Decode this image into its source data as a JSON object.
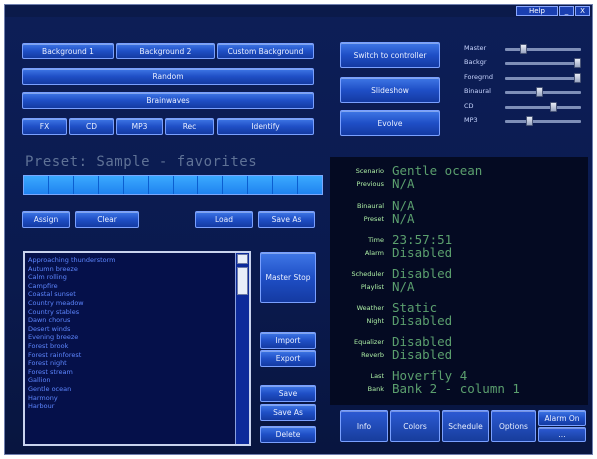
{
  "titlebar": {
    "help": "Help",
    "minimize": "_",
    "close": "X"
  },
  "top_buttons": {
    "background1": "Background 1",
    "background2": "Background 2",
    "custom_background": "Custom Background",
    "random": "Random",
    "brainwaves": "Brainwaves",
    "fx": "FX",
    "cd": "CD",
    "mp3": "MP3",
    "rec": "Rec",
    "identify": "Identify"
  },
  "mid_buttons": {
    "switch_to_controller": "Switch to controller",
    "slideshow": "Slideshow",
    "evolve": "Evolve"
  },
  "sliders": [
    {
      "label": "Master",
      "level": 0.22
    },
    {
      "label": "Backgr",
      "level": 1.0
    },
    {
      "label": "Foregrnd",
      "level": 1.0
    },
    {
      "label": "Binaural",
      "level": 0.45
    },
    {
      "label": "CD",
      "level": 0.65
    },
    {
      "label": "MP3",
      "level": 0.3
    }
  ],
  "preset": {
    "title": "Preset: Sample - favorites",
    "assign": "Assign",
    "clear": "Clear",
    "load": "Load",
    "save_as": "Save As"
  },
  "playlist": {
    "items": [
      "Approaching thunderstorm",
      "Autumn breeze",
      "Calm rolling",
      "Campfire",
      "Coastal sunset",
      "Country meadow",
      "Country stables",
      "Dawn chorus",
      "Desert winds",
      "Evening breeze",
      "Forest brook",
      "Forest rainforest",
      "Forest night",
      "Forest stream",
      "Gallion",
      "Gentle ocean",
      "Harmony",
      "Harbour"
    ]
  },
  "side_buttons": {
    "master_stop": "Master Stop",
    "import": "Import",
    "export": "Export",
    "save": "Save",
    "save_as": "Save As",
    "delete": "Delete"
  },
  "info": [
    {
      "label": "Scenario",
      "value": "Gentle ocean"
    },
    {
      "label": "Previous",
      "value": "N/A"
    },
    {
      "label": "Binaural",
      "value": "N/A"
    },
    {
      "label": "Preset",
      "value": "N/A"
    },
    {
      "label": "Time",
      "value": "23:57:51"
    },
    {
      "label": "Alarm",
      "value": "Disabled"
    },
    {
      "label": "Scheduler",
      "value": "Disabled"
    },
    {
      "label": "Playlist",
      "value": "N/A"
    },
    {
      "label": "Weather",
      "value": "Static"
    },
    {
      "label": "Night",
      "value": "Disabled"
    },
    {
      "label": "Equalizer",
      "value": "Disabled"
    },
    {
      "label": "Reverb",
      "value": "Disabled"
    },
    {
      "label": "Last",
      "value": "Hoverfly 4"
    },
    {
      "label": "Bank",
      "value": "Bank 2 - column 1"
    }
  ],
  "bottom_buttons": {
    "info": "Info",
    "colors": "Colors",
    "schedule": "Schedule",
    "options": "Options",
    "alarm_on": "Alarm On",
    "alarm_extra": "..."
  },
  "colors": {
    "background": "#0a1a4e",
    "button": "#1f4fc6",
    "accent_cells": "#2a96ff",
    "info_text": "#5b9f6e"
  }
}
